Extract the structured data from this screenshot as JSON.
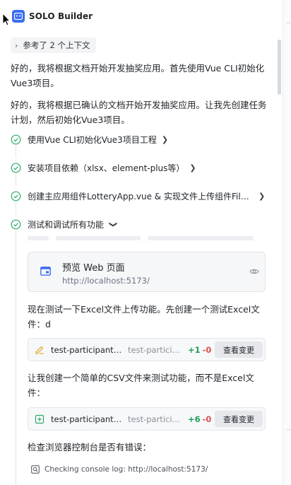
{
  "header": {
    "app_title": "SOLO Builder"
  },
  "context_chip": {
    "label": "参考了 2 个上下文"
  },
  "messages": {
    "intro": "好的，我将根据文档开始开发抽奖应用。首先使用Vue CLI初始化Vue3项目。",
    "plan": "好的，我将根据已确认的文档开始开发抽奖应用。让我先创建任务计划，然后初始化Vue3项目。",
    "test_excel": "现在测试一下Excel文件上传功能。先创建一个测试Excel文件：d",
    "create_csv": "让我创建一个简单的CSV文件来测试功能，而不是Excel文件：",
    "check_console": "检查浏览器控制台是否有错误："
  },
  "steps": [
    {
      "label": "使用Vue CLI初始化Vue3项目工程",
      "status": "done"
    },
    {
      "label": "安装项目依赖（xlsx、element-plus等）",
      "status": "done"
    },
    {
      "label": "创建主应用组件LotteryApp.vue & 实现文件上传组件FileUpl...",
      "status": "done"
    },
    {
      "label": "测试和调试所有功能",
      "status": "done",
      "expanded": true
    }
  ],
  "preview": {
    "title": "预览 Web 页面",
    "url": "http://localhost:5173/",
    "icon": "browser-window-icon"
  },
  "files": [
    {
      "name": "test-participants.x...",
      "path": "test-particip...",
      "added": "+1",
      "removed": "-0",
      "button": "查看变更",
      "icon": "edit-icon"
    },
    {
      "name": "test-participants.c...",
      "path": "test-particip...",
      "added": "+6",
      "removed": "-0",
      "button": "查看变更",
      "icon": "new-file-icon"
    }
  ],
  "console": {
    "text": "Checking console log: http://localhost:5173/"
  },
  "colors": {
    "accent": "#3b6df2",
    "success": "#2eaa6a",
    "added": "#1f9d55",
    "removed": "#d9534f"
  }
}
